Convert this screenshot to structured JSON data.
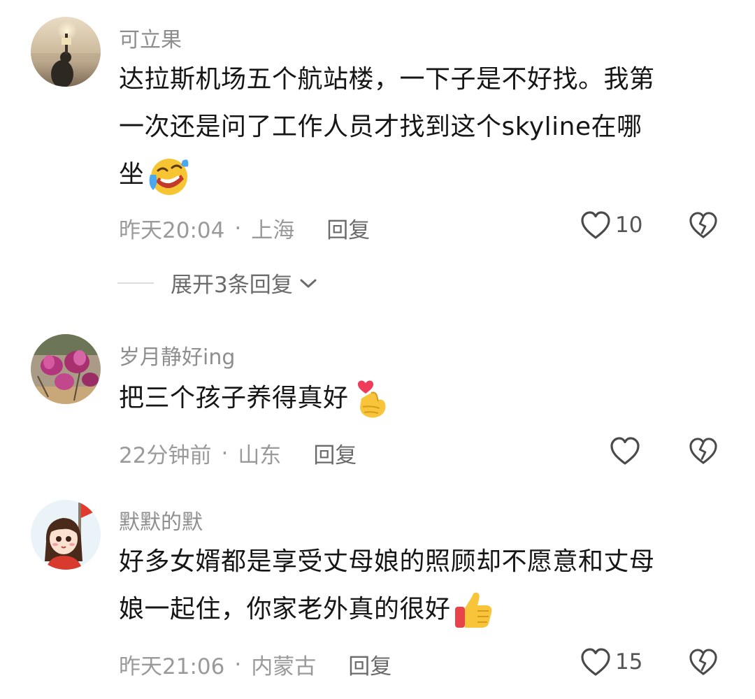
{
  "comments": [
    {
      "username": "可立果",
      "content_lines": [
        "达拉斯机场五个航站楼，一下子是不好找。我第",
        "一次还是问了工作人员才找到这个skyline在哪",
        "坐"
      ],
      "emoji": "crying-laughing-emoji",
      "time": "昨天20:04",
      "separator": "·",
      "location": "上海",
      "reply_label": "回复",
      "like_count": "10",
      "expand_label": "展开3条回复"
    },
    {
      "username": "岁月静好ing",
      "content_lines": [
        "把三个孩子养得真好"
      ],
      "emoji": "finger-heart-emoji",
      "time": "22分钟前",
      "separator": "·",
      "location": "山东",
      "reply_label": "回复",
      "like_count": ""
    },
    {
      "username": "默默的默",
      "content_lines": [
        "好多女婿都是享受丈母娘的照顾却不愿意和丈母",
        "娘一起住，你家老外真的很好"
      ],
      "emoji": "thumbs-up-emoji",
      "time": "昨天21:06",
      "separator": "·",
      "location": "内蒙古",
      "reply_label": "回复",
      "like_count": "15"
    }
  ],
  "icons": {
    "like": "heart-outline-icon",
    "dislike": "broken-heart-icon",
    "expand": "chevron-down-icon"
  },
  "colors": {
    "meta_text": "#9a9a9a",
    "username_text": "#8e8e8e",
    "content_text": "#161616"
  }
}
